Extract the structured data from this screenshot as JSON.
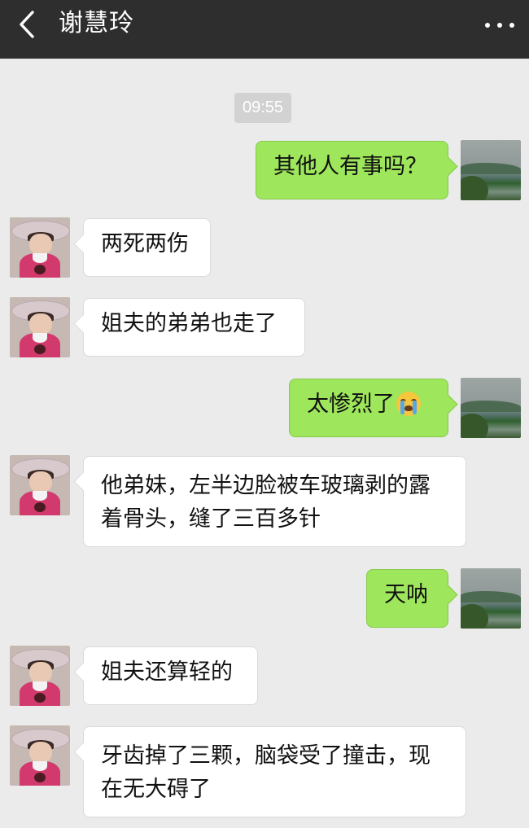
{
  "header": {
    "title": "谢慧玲"
  },
  "timestamp": "09:55",
  "messages": [
    {
      "side": "right",
      "text": "其他人有事吗？"
    },
    {
      "side": "left",
      "text": "两死两伤"
    },
    {
      "side": "left",
      "text": "姐夫的弟弟也走了"
    },
    {
      "side": "right",
      "text": "太惨烈了",
      "emoji": "loudly-crying-face"
    },
    {
      "side": "left",
      "text": "他弟妹，左半边脸被车玻璃剥的露着骨头，缝了三百多针"
    },
    {
      "side": "right",
      "text": "天呐"
    },
    {
      "side": "left",
      "text": "姐夫还算轻的"
    },
    {
      "side": "left",
      "text": "牙齿掉了三颗，脑袋受了撞击，现在无大碍了"
    }
  ],
  "colors": {
    "header_bg": "#2e2e2e",
    "chat_bg": "#ebebeb",
    "sent_bubble": "#9ee65b",
    "received_bubble": "#ffffff"
  }
}
